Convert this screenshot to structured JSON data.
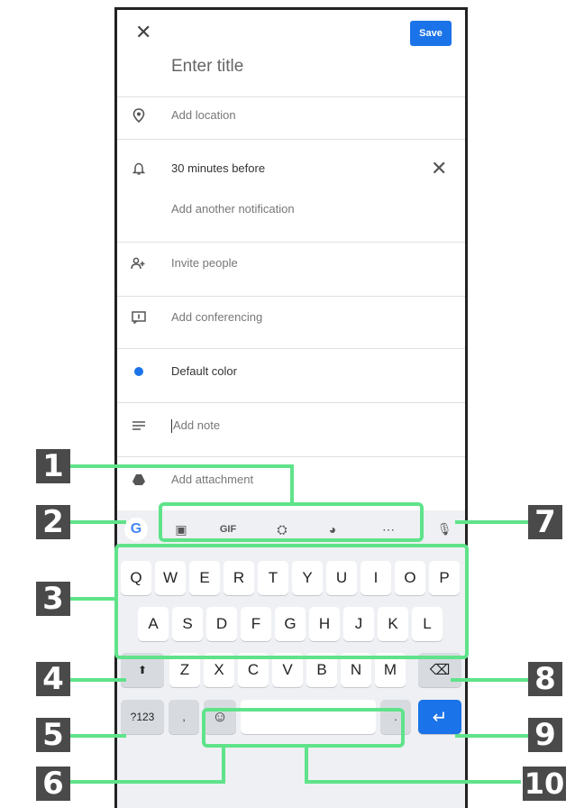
{
  "header": {
    "close_glyph": "✕",
    "save_label": "Save",
    "title_placeholder": "Enter title"
  },
  "rows": [
    {
      "icon": "location-pin-icon",
      "label": "Add location"
    },
    {
      "icon": "bell-icon",
      "label": "30 minutes before"
    },
    {
      "icon": "",
      "label": "Add another notification"
    },
    {
      "icon": "people-icon",
      "label": "Invite people"
    },
    {
      "icon": "conferencing-icon",
      "label": "Add conferencing"
    },
    {
      "icon": "color-dot-icon",
      "label": "Default color"
    },
    {
      "icon": "notes-icon",
      "label": "Add note"
    },
    {
      "icon": "drive-icon",
      "label": "Add attachment"
    }
  ],
  "keyboard": {
    "google_logo": "G",
    "toolbar_icons": [
      {
        "name": "sticker-icon",
        "glyph": "▣"
      },
      {
        "name": "gif-icon",
        "glyph": "GIF"
      },
      {
        "name": "translate-icon",
        "glyph": "⛭"
      },
      {
        "name": "palette-icon",
        "glyph": "◕"
      },
      {
        "name": "more-icon",
        "glyph": "⋯"
      },
      {
        "name": "mic-icon",
        "glyph": "🎙"
      }
    ],
    "row1": [
      "Q",
      "W",
      "E",
      "R",
      "T",
      "Y",
      "U",
      "I",
      "O",
      "P"
    ],
    "row2": [
      "A",
      "S",
      "D",
      "F",
      "G",
      "H",
      "J",
      "K",
      "L"
    ],
    "row3": [
      "Z",
      "X",
      "C",
      "V",
      "B",
      "N",
      "M"
    ],
    "shift_glyph": "⬆",
    "backspace_glyph": "⌫",
    "symbols_label": "?123",
    "comma_label": ",",
    "emoji_glyph": "☺",
    "period_label": ".",
    "enter_glyph": "↵"
  },
  "callouts": [
    "1",
    "2",
    "3",
    "4",
    "5",
    "6",
    "7",
    "8",
    "9",
    "10"
  ],
  "colors": {
    "accent": "#1a73e8",
    "callout_green": "#5fe38a",
    "badge": "#4a4a4a"
  }
}
